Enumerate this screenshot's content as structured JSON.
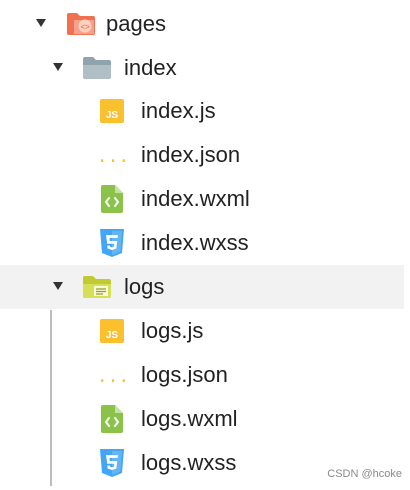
{
  "tree": {
    "root": {
      "label": "pages",
      "icon": "pages-folder-icon",
      "expanded": true,
      "children": [
        {
          "label": "index",
          "icon": "folder-icon",
          "expanded": true,
          "files": [
            {
              "label": "index.js",
              "icon": "js-file-icon"
            },
            {
              "label": "index.json",
              "icon": "json-file-icon"
            },
            {
              "label": "index.wxml",
              "icon": "wxml-file-icon"
            },
            {
              "label": "index.wxss",
              "icon": "wxss-file-icon"
            }
          ]
        },
        {
          "label": "logs",
          "icon": "logs-folder-icon",
          "expanded": true,
          "selected": true,
          "files": [
            {
              "label": "logs.js",
              "icon": "js-file-icon"
            },
            {
              "label": "logs.json",
              "icon": "json-file-icon"
            },
            {
              "label": "logs.wxml",
              "icon": "wxml-file-icon"
            },
            {
              "label": "logs.wxss",
              "icon": "wxss-file-icon"
            }
          ]
        }
      ]
    }
  },
  "icon_labels": {
    "js": "JS",
    "json": "{...}"
  },
  "colors": {
    "pages_folder": "#f07050",
    "folder_gray": "#90a4ae",
    "logs_folder": "#c0ca33",
    "js": "#fbc02d",
    "json": "#fbc02d",
    "wxml": "#8bc34a",
    "wxss": "#42a5f5",
    "selected_row": "#f2f2f2"
  },
  "watermark": "CSDN @hcoke"
}
